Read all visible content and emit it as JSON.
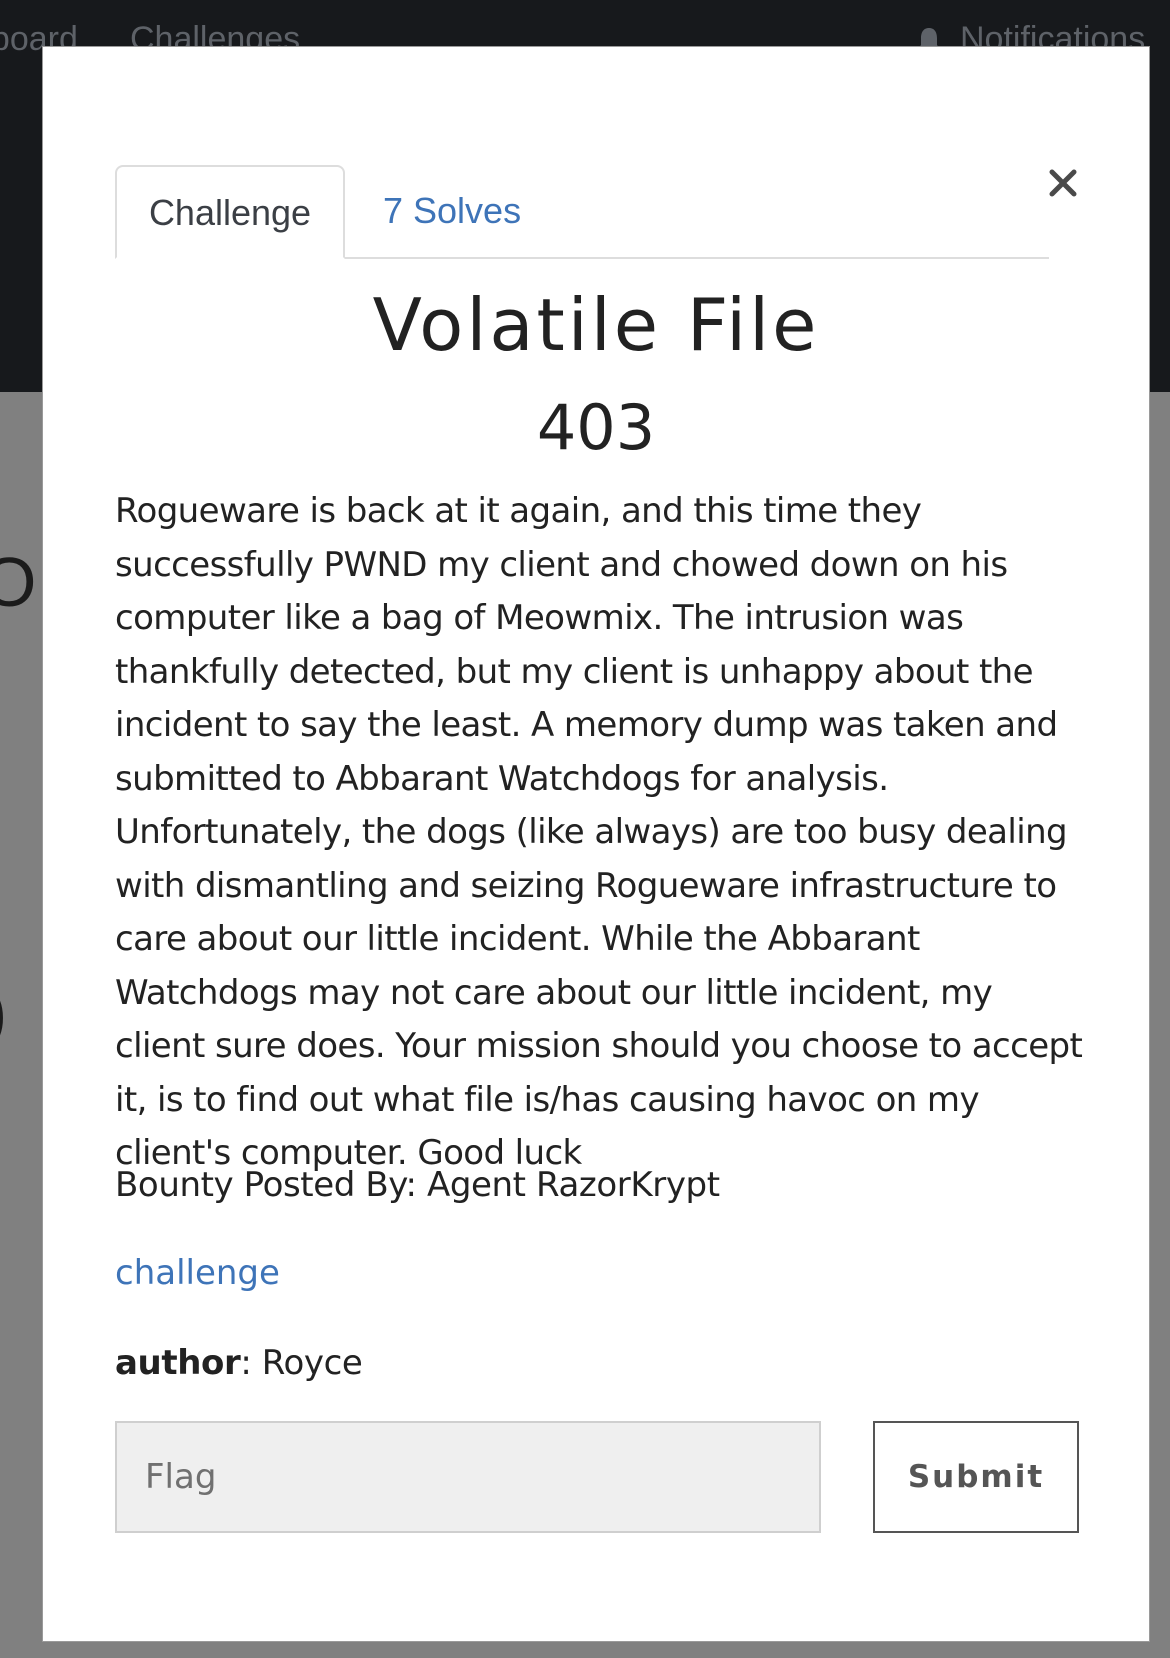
{
  "background": {
    "nav_items": [
      "eboard",
      "Challenges",
      "Notifications"
    ]
  },
  "modal": {
    "tabs": [
      {
        "label": "Challenge"
      },
      {
        "label": "7 Solves"
      }
    ],
    "close_label": "×",
    "title": "Volatile File",
    "points": "403",
    "description": "Rogueware is back at it again, and this time they successfully PWND my client and chowed down on his computer like a bag of Meowmix. The intrusion was thankfully detected, but my client is unhappy about the incident to say the least. A memory dump was taken and submitted to Abbarant Watchdogs for analysis. Unfortunately, the dogs (like always) are too busy dealing with dismantling and seizing Rogueware infrastructure to care about our little incident. While the Abbarant Watchdogs may not care about our little incident, my client sure does. Your mission should you choose to accept it, is to find out what file is/has causing havoc on my client's computer. Good luck",
    "bounty": "Bounty Posted By: Agent RazorKrypt",
    "tag": "challenge",
    "author_label": "author",
    "author_value": ": Royce",
    "flag_placeholder": "Flag",
    "flag_value": "",
    "submit_label": "Submit"
  },
  "colors": {
    "accent": "#3e74b8",
    "nav_bg": "#17191c",
    "overlay_bg": "#808080"
  }
}
